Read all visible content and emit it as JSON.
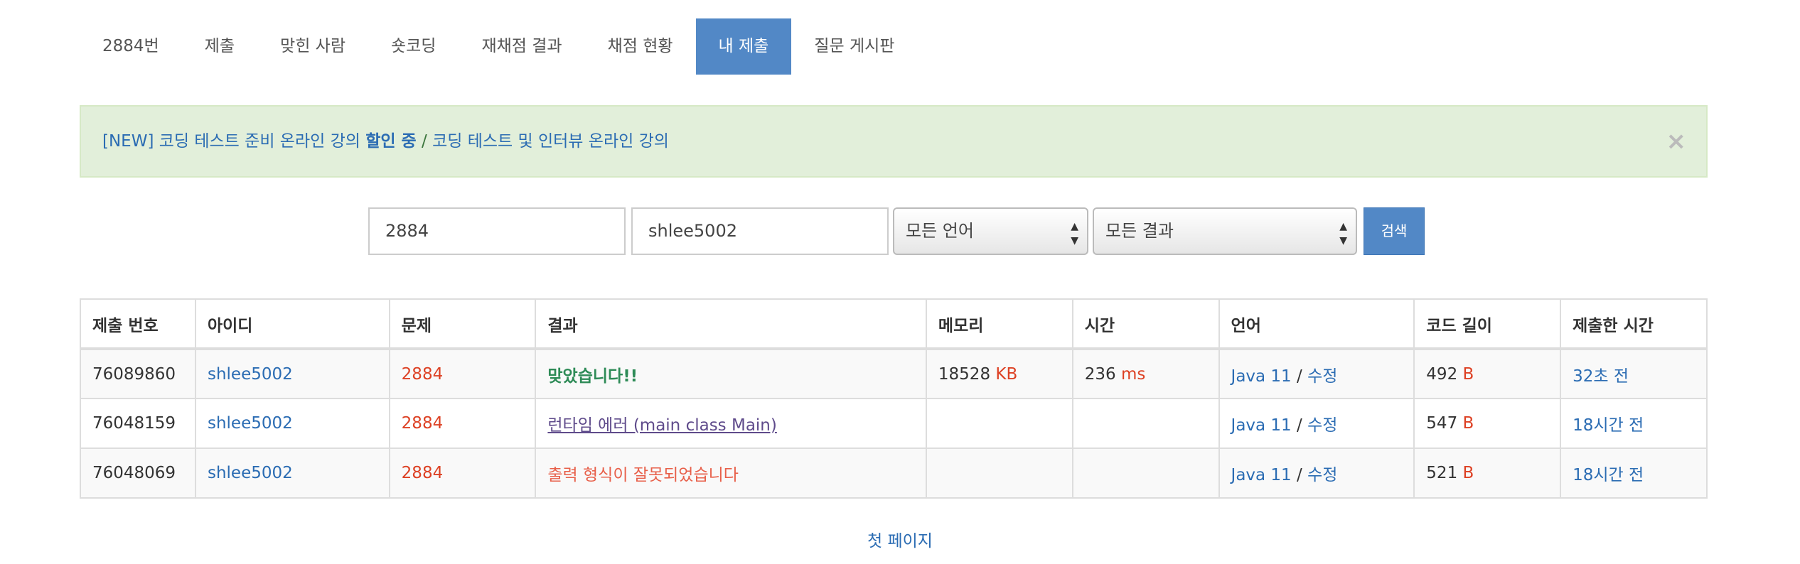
{
  "nav": {
    "tabs": [
      {
        "label": "2884번"
      },
      {
        "label": "제출"
      },
      {
        "label": "맞힌 사람"
      },
      {
        "label": "숏코딩"
      },
      {
        "label": "재채점 결과"
      },
      {
        "label": "채점 현황"
      },
      {
        "label": "내 제출",
        "active": true
      },
      {
        "label": "질문 게시판"
      }
    ]
  },
  "alert": {
    "link1": "[NEW] 코딩 테스트 준비 온라인 강의",
    "link1_bold": "할인 중",
    "sep": " / ",
    "link2": "코딩 테스트 및 인터뷰 온라인 강의",
    "close": "×"
  },
  "search": {
    "problem": "2884",
    "user": "shlee5002",
    "language": "모든 언어",
    "result": "모든 결과",
    "button": "검색"
  },
  "table": {
    "headers": [
      "제출 번호",
      "아이디",
      "문제",
      "결과",
      "메모리",
      "시간",
      "언어",
      "코드 길이",
      "제출한 시간"
    ],
    "rows": [
      {
        "id": "76089860",
        "user": "shlee5002",
        "problem": "2884",
        "result": "맞았습니다!!",
        "result_type": "ac",
        "memory": "18528",
        "memory_unit": "KB",
        "time": "236",
        "time_unit": "ms",
        "lang": "Java 11",
        "sep": " / ",
        "edit": "수정",
        "length": "492",
        "length_unit": "B",
        "submitted": "32초 전"
      },
      {
        "id": "76048159",
        "user": "shlee5002",
        "problem": "2884",
        "result": "런타임 에러 (main class Main)",
        "result_type": "rte",
        "memory": "",
        "memory_unit": "",
        "time": "",
        "time_unit": "",
        "lang": "Java 11",
        "sep": " / ",
        "edit": "수정",
        "length": "547",
        "length_unit": "B",
        "submitted": "18시간 전"
      },
      {
        "id": "76048069",
        "user": "shlee5002",
        "problem": "2884",
        "result": "출력 형식이 잘못되었습니다",
        "result_type": "pe",
        "memory": "",
        "memory_unit": "",
        "time": "",
        "time_unit": "",
        "lang": "Java 11",
        "sep": " / ",
        "edit": "수정",
        "length": "521",
        "length_unit": "B",
        "submitted": "18시간 전"
      }
    ]
  },
  "pager": {
    "first": "첫 페이지"
  },
  "colors": {
    "accent": "#5288c6",
    "link": "#2b6cb3",
    "accepted": "#2e8b57",
    "error": "#dd4124",
    "alert_bg": "#e2efda"
  }
}
